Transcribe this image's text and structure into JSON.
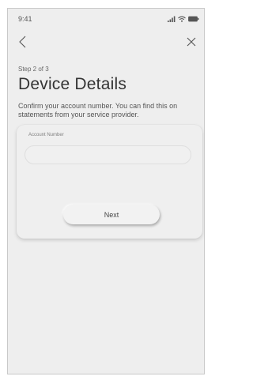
{
  "status_bar": {
    "time": "9:41",
    "icons": [
      "cellular-signal-icon",
      "wifi-icon",
      "battery-icon"
    ]
  },
  "nav": {
    "back_icon": "chevron-left-icon",
    "close_icon": "close-icon"
  },
  "header": {
    "step": "Step 2 of 3",
    "title": "Device Details",
    "description": "Confirm your account number. You can find this on statements from your service provider."
  },
  "form": {
    "account_number_label": "Account Number",
    "account_number_value": "",
    "next_label": "Next"
  }
}
